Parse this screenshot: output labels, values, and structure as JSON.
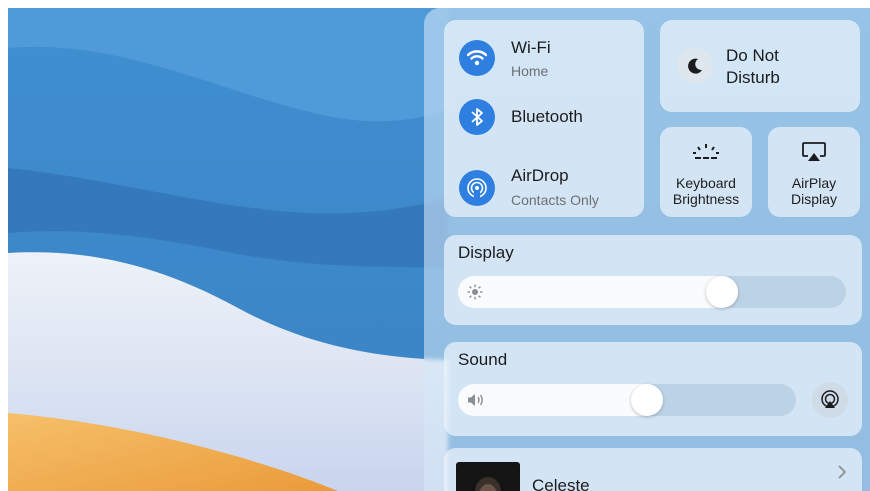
{
  "controls": {
    "wifi": {
      "label": "Wi-Fi",
      "status": "Home",
      "icon": "wifi-icon"
    },
    "bluetooth": {
      "label": "Bluetooth",
      "icon": "bluetooth-icon"
    },
    "airdrop": {
      "label": "AirDrop",
      "status": "Contacts Only",
      "icon": "airdrop-icon"
    },
    "do_not_disturb": {
      "line1": "Do Not",
      "line2": "Disturb",
      "icon": "moon-icon"
    },
    "keyboard_brightness": {
      "line1": "Keyboard",
      "line2": "Brightness",
      "icon": "keyboard-brightness-icon"
    },
    "airplay_display": {
      "line1": "AirPlay",
      "line2": "Display",
      "icon": "airplay-display-icon"
    }
  },
  "display": {
    "label": "Display",
    "level": 0.68,
    "icon": "sun-icon"
  },
  "sound": {
    "label": "Sound",
    "level": 0.56,
    "icon": "speaker-icon",
    "output_icon": "airplay-audio-icon"
  },
  "now_playing": {
    "artist": "Celeste",
    "icon": "chevron-right-icon"
  },
  "colors": {
    "accent": "#2f7fe0",
    "wallpaper_blue": "#3f86c8",
    "wallpaper_orange": "#f0a44a"
  }
}
